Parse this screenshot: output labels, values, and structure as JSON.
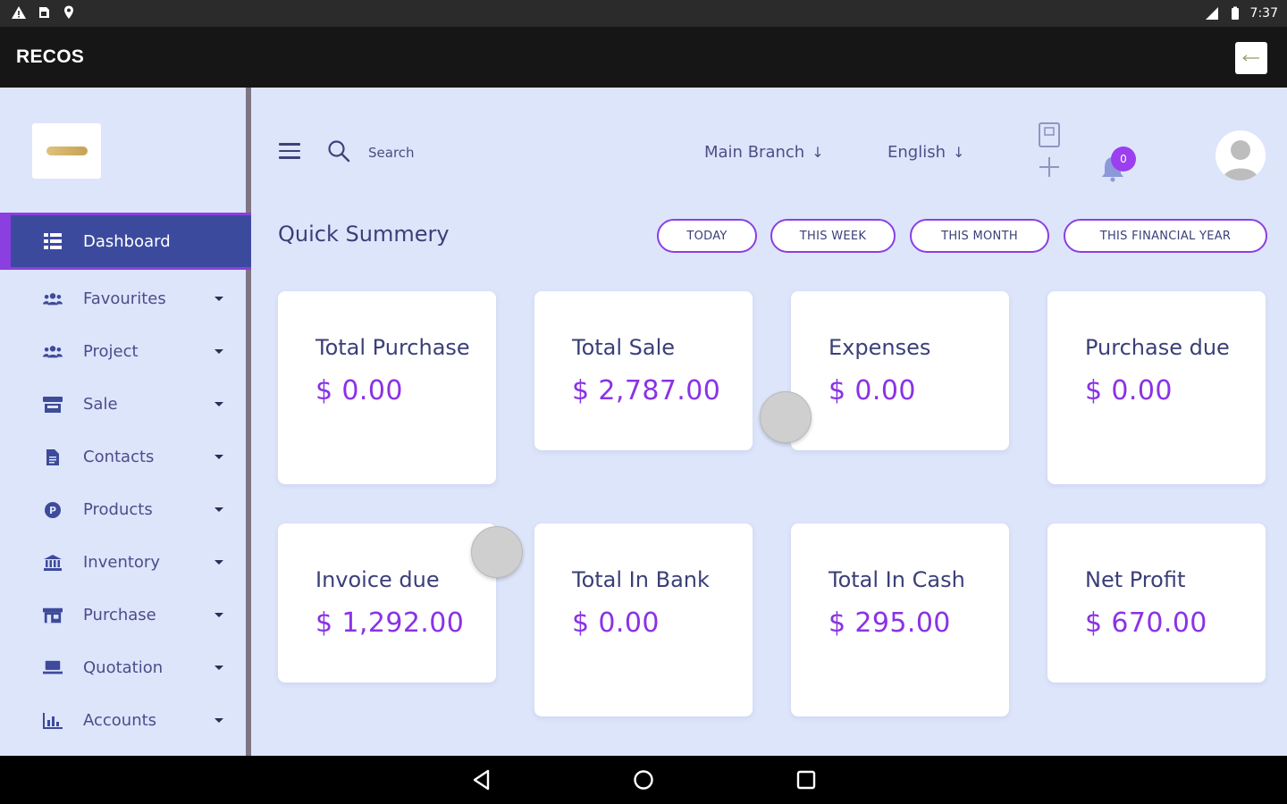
{
  "status_bar": {
    "time": "7:37"
  },
  "app_bar": {
    "title": "RECOS"
  },
  "sidebar": {
    "items": [
      {
        "label": "Dashboard",
        "icon": "grid-icon",
        "active": true
      },
      {
        "label": "Favourites",
        "icon": "users-icon"
      },
      {
        "label": "Project",
        "icon": "users-icon"
      },
      {
        "label": "Sale",
        "icon": "store-icon"
      },
      {
        "label": "Contacts",
        "icon": "file-icon"
      },
      {
        "label": "Products",
        "icon": "product-icon"
      },
      {
        "label": "Inventory",
        "icon": "bank-icon"
      },
      {
        "label": "Purchase",
        "icon": "shop-icon"
      },
      {
        "label": "Quotation",
        "icon": "quotation-icon"
      },
      {
        "label": "Accounts",
        "icon": "chart-icon"
      }
    ]
  },
  "header": {
    "search_placeholder": "Search",
    "branch": "Main Branch",
    "language": "English",
    "notification_count": "0"
  },
  "summary": {
    "title": "Quick Summery",
    "filters": [
      "TODAY",
      "THIS WEEK",
      "THIS MONTH",
      "THIS FINANCIAL YEAR"
    ],
    "cards": [
      {
        "title": "Total Purchase",
        "value": "$ 0.00"
      },
      {
        "title": "Total Sale",
        "value": "$ 2,787.00"
      },
      {
        "title": "Expenses",
        "value": "$ 0.00"
      },
      {
        "title": "Purchase due",
        "value": "$ 0.00"
      },
      {
        "title": "Invoice due",
        "value": "$ 1,292.00"
      },
      {
        "title": "Total In Bank",
        "value": "$ 0.00"
      },
      {
        "title": "Total In Cash",
        "value": "$ 295.00"
      },
      {
        "title": "Net Profit",
        "value": "$ 670.00"
      }
    ]
  },
  "colors": {
    "accent": "#8b3fe0",
    "sidebar_active": "#3c4a9e",
    "background": "#dde5fb",
    "text": "#3a3f78",
    "value": "#8a32e6"
  }
}
